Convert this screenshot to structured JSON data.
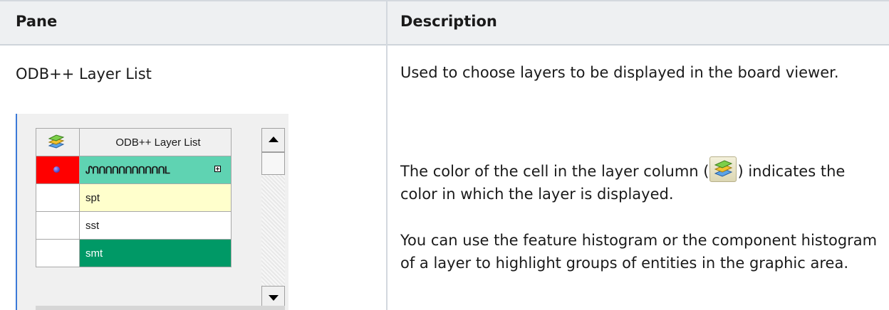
{
  "table": {
    "headers": [
      "Pane",
      "Description"
    ],
    "pane_name": "ODB++ Layer List",
    "description": {
      "p1": "Used to choose layers to be displayed in the board viewer.",
      "p2_before": "The color of the cell in the layer column (",
      "p2_after": ") indicates the color in which the layer is displayed.",
      "p3": "You can use the feature histogram or the component histogram of a layer to highlight groups of entities in the graphic area."
    }
  },
  "layer_list": {
    "column_header": "ODB++ Layer List",
    "rows": [
      {
        "name": "ᔑᑎᑎᑎᑎᑎᑎᑎᑎᑎᑎᑎᒪ",
        "color": "#ff0000",
        "bg": "#5fd3b2",
        "expandable": true,
        "visible_marker": true
      },
      {
        "name": "spt",
        "color": "#ffffff",
        "bg": "#ffffcc",
        "expandable": false,
        "visible_marker": false
      },
      {
        "name": "sst",
        "color": "#ffffff",
        "bg": "#ffffff",
        "expandable": false,
        "visible_marker": false
      },
      {
        "name": "smt",
        "color": "#ffffff",
        "bg": "#009966",
        "expandable": false,
        "visible_marker": false
      }
    ]
  },
  "icons": {
    "layers": "layers-icon",
    "scroll_up": "scroll-up-icon",
    "scroll_down": "scroll-down-icon"
  }
}
